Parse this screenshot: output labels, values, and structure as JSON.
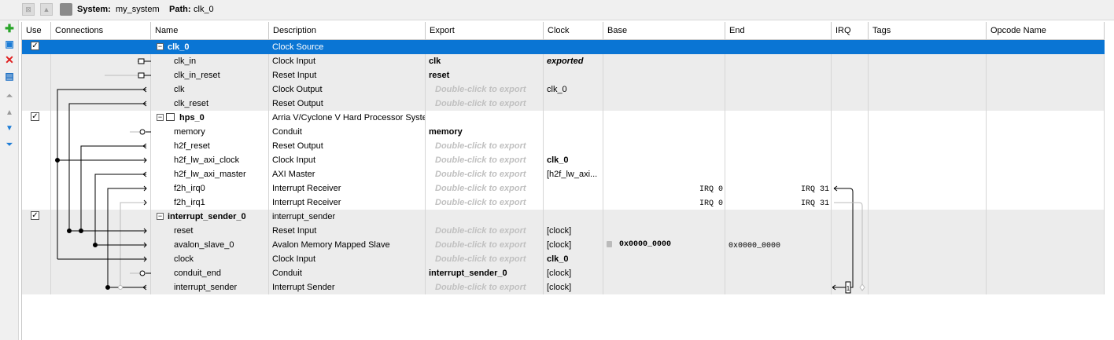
{
  "topbar": {
    "system_label": "System:",
    "system_value": "my_system",
    "path_label": "Path:",
    "path_value": "clk_0"
  },
  "toolbar_icons": [
    "add-icon",
    "add-component-icon",
    "remove-icon",
    "edit-icon",
    "move-top-icon",
    "move-up-icon",
    "move-down-icon",
    "move-bottom-icon"
  ],
  "columns": [
    "Use",
    "Connections",
    "Name",
    "Description",
    "Export",
    "Clock",
    "Base",
    "End",
    "IRQ",
    "Tags",
    "Opcode Name"
  ],
  "rows": [
    {
      "kind": "component",
      "use": true,
      "name": "clk_0",
      "description": "Clock Source",
      "export": "",
      "export_style": "",
      "clock": "",
      "base": "",
      "end": "",
      "irq": "",
      "selected": true
    },
    {
      "kind": "port",
      "name": "clk_in",
      "description": "Clock Input",
      "export": "clk",
      "export_style": "bold",
      "clock": "exported",
      "clock_style": "exported",
      "base": "",
      "end": ""
    },
    {
      "kind": "port",
      "name": "clk_in_reset",
      "description": "Reset Input",
      "export": "reset",
      "export_style": "bold",
      "clock": "",
      "base": "",
      "end": ""
    },
    {
      "kind": "port",
      "name": "clk",
      "description": "Clock Output",
      "export": "Double-click to export",
      "export_style": "dbl",
      "clock": "clk_0",
      "base": "",
      "end": ""
    },
    {
      "kind": "port",
      "name": "clk_reset",
      "description": "Reset Output",
      "export": "Double-click to export",
      "export_style": "dbl",
      "clock": "",
      "base": "",
      "end": ""
    },
    {
      "kind": "component",
      "use": true,
      "name": "hps_0",
      "description": "Arria V/Cyclone V Hard Processor System",
      "export": "",
      "export_style": "",
      "clock": "",
      "base": "",
      "end": "",
      "irq": ""
    },
    {
      "kind": "port",
      "name": "memory",
      "description": "Conduit",
      "export": "memory",
      "export_style": "bold",
      "clock": "",
      "base": "",
      "end": ""
    },
    {
      "kind": "port",
      "name": "h2f_reset",
      "description": "Reset Output",
      "export": "Double-click to export",
      "export_style": "dbl",
      "clock": "",
      "base": "",
      "end": ""
    },
    {
      "kind": "port",
      "name": "h2f_lw_axi_clock",
      "description": "Clock Input",
      "export": "Double-click to export",
      "export_style": "dbl",
      "clock": "clk_0",
      "clock_style": "bold",
      "base": "",
      "end": ""
    },
    {
      "kind": "port",
      "name": "h2f_lw_axi_master",
      "description": "AXI Master",
      "export": "Double-click to export",
      "export_style": "dbl",
      "clock": "[h2f_lw_axi...",
      "base": "",
      "end": ""
    },
    {
      "kind": "port",
      "name": "f2h_irq0",
      "description": "Interrupt Receiver",
      "export": "Double-click to export",
      "export_style": "dbl",
      "clock": "",
      "base": "IRQ 0",
      "end": "IRQ 31"
    },
    {
      "kind": "port",
      "name": "f2h_irq1",
      "description": "Interrupt Receiver",
      "export": "Double-click to export",
      "export_style": "dbl",
      "clock": "",
      "base": "IRQ 0",
      "end": "IRQ 31"
    },
    {
      "kind": "component",
      "use": true,
      "name": "interrupt_sender_0",
      "description": "interrupt_sender",
      "export": "",
      "export_style": "",
      "clock": "",
      "base": "",
      "end": "",
      "irq": ""
    },
    {
      "kind": "port",
      "name": "reset",
      "description": "Reset Input",
      "export": "Double-click to export",
      "export_style": "dbl",
      "clock": "[clock]",
      "base": "",
      "end": ""
    },
    {
      "kind": "port",
      "name": "avalon_slave_0",
      "description": "Avalon Memory Mapped Slave",
      "export": "Double-click to export",
      "export_style": "dbl",
      "clock": "[clock]",
      "base": "0x0000_0000",
      "end": "0x0000_0000",
      "locked": true
    },
    {
      "kind": "port",
      "name": "clock",
      "description": "Clock Input",
      "export": "Double-click to export",
      "export_style": "dbl",
      "clock": "clk_0",
      "clock_style": "bold",
      "base": "",
      "end": ""
    },
    {
      "kind": "port",
      "name": "conduit_end",
      "description": "Conduit",
      "export": "interrupt_sender_0",
      "export_style": "bold",
      "clock": "[clock]",
      "base": "",
      "end": ""
    },
    {
      "kind": "port",
      "name": "interrupt_sender",
      "description": "Interrupt Sender",
      "export": "Double-click to export",
      "export_style": "dbl",
      "clock": "[clock]",
      "base": "",
      "end": "",
      "irq": "1"
    }
  ],
  "colors": {
    "selection": "#0a75d4",
    "row_grey": "#ececec",
    "placeholder": "#c0c0c0"
  }
}
